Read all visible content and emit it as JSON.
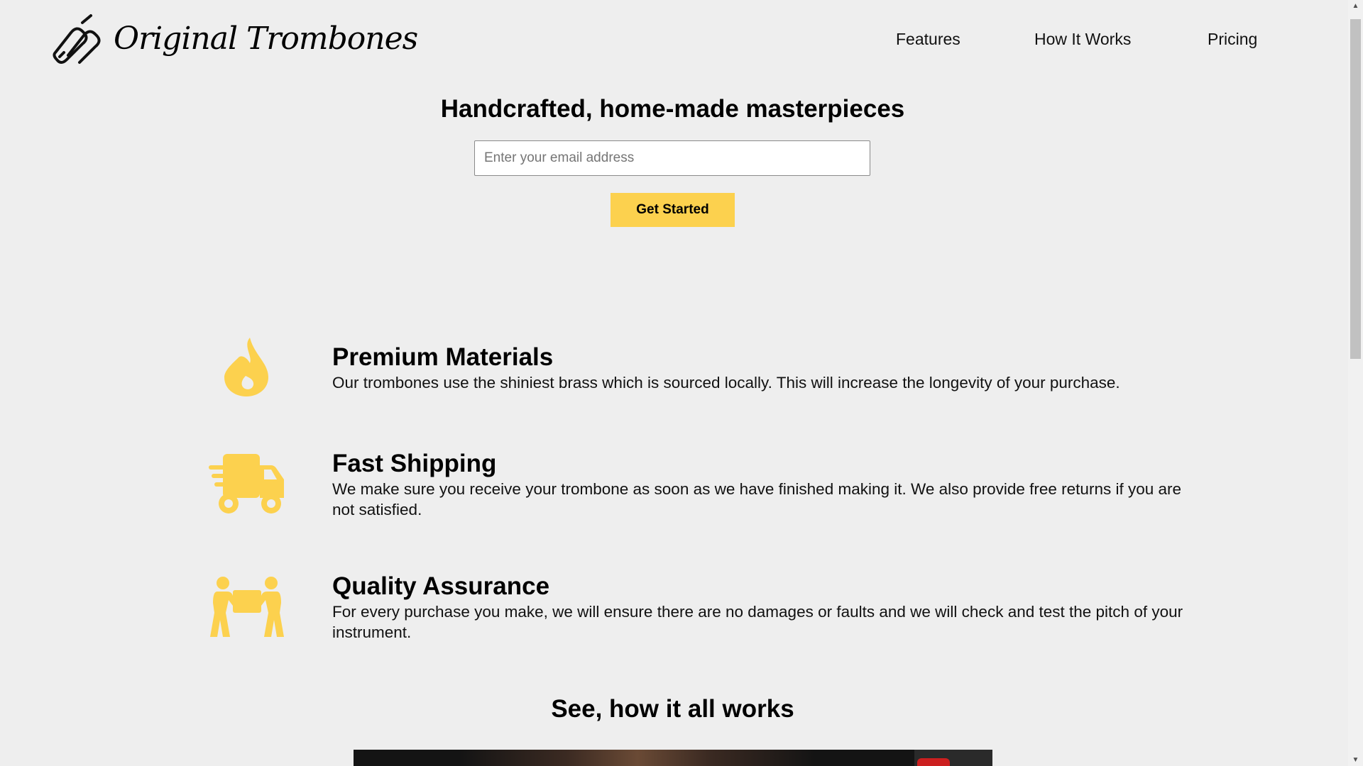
{
  "header": {
    "brand": "Original Trombones",
    "logo_icon": "trombone-icon",
    "nav": [
      {
        "label": "Features"
      },
      {
        "label": "How It Works"
      },
      {
        "label": "Pricing"
      }
    ]
  },
  "hero": {
    "title": "Handcrafted, home-made masterpieces",
    "email_placeholder": "Enter your email address",
    "cta_label": "Get Started"
  },
  "features": [
    {
      "icon": "fire-icon",
      "title": "Premium Materials",
      "description": "Our trombones use the shiniest brass which is sourced locally. This will increase the longevity of your purchase."
    },
    {
      "icon": "shipping-truck-icon",
      "title": "Fast Shipping",
      "description": "We make sure you receive your trombone as soon as we have finished making it. We also provide free returns if you are not satisfied."
    },
    {
      "icon": "people-carry-icon",
      "title": "Quality Assurance",
      "description": "For every purchase you make, we will ensure there are no damages or faults and we will check and test the pitch of your instrument."
    }
  ],
  "how_it_works": {
    "title": "See, how it all works"
  },
  "colors": {
    "accent": "#fcd14e",
    "background": "#eeeeee",
    "text": "#000000"
  }
}
